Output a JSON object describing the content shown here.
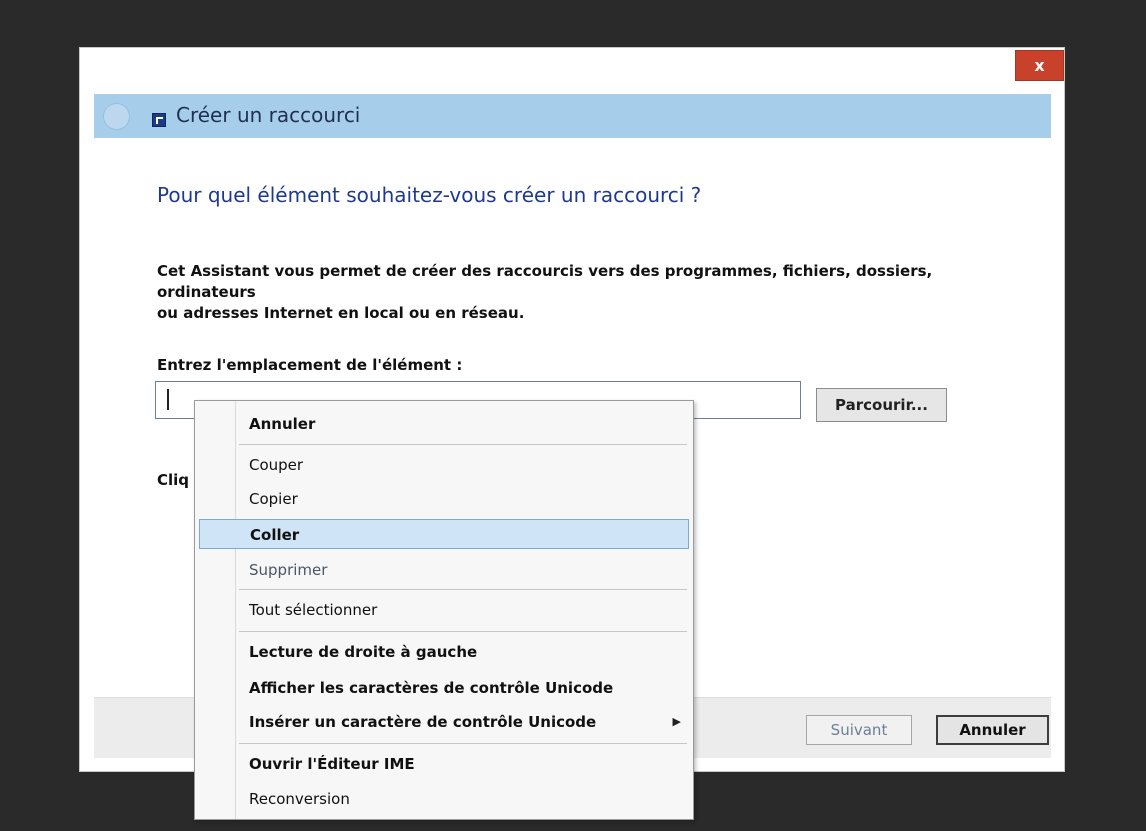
{
  "window": {
    "title": "Créer un raccourci",
    "close_glyph": "x",
    "icons": {
      "back": "back-arrow-icon",
      "app": "shortcut-icon"
    }
  },
  "content": {
    "heading": "Pour quel élément souhaitez-vous créer un raccourci ?",
    "description_line1": "Cet Assistant vous permet de créer des raccourcis vers des programmes, fichiers, dossiers, ordinateurs",
    "description_line2": "ou adresses Internet en local ou en réseau.",
    "field_label": "Entrez l'emplacement de l'élément :",
    "location_value": "",
    "browse_label": "Parcourir...",
    "partial_instruction": "Cliq"
  },
  "footer": {
    "next_label": "Suivant",
    "cancel_label": "Annuler"
  },
  "context_menu": {
    "items": [
      {
        "label": "Annuler"
      },
      {
        "label": "Couper"
      },
      {
        "label": "Copier"
      },
      {
        "label": "Coller",
        "selected": true
      },
      {
        "label": "Supprimer"
      },
      {
        "label": "Tout sélectionner"
      },
      {
        "label": "Lecture de droite à gauche"
      },
      {
        "label": "Afficher les caractères de contrôle Unicode"
      },
      {
        "label": "Insérer un caractère de contrôle Unicode",
        "submenu": true
      },
      {
        "label": "Ouvrir l'Éditeur IME"
      },
      {
        "label": "Reconversion"
      }
    ],
    "submenu_arrow": "▶"
  },
  "colors": {
    "titlebar": "#a6cdea",
    "heading": "#1e3a8c",
    "close": "#c7412b",
    "menu_selected": "#cfe4f7"
  }
}
